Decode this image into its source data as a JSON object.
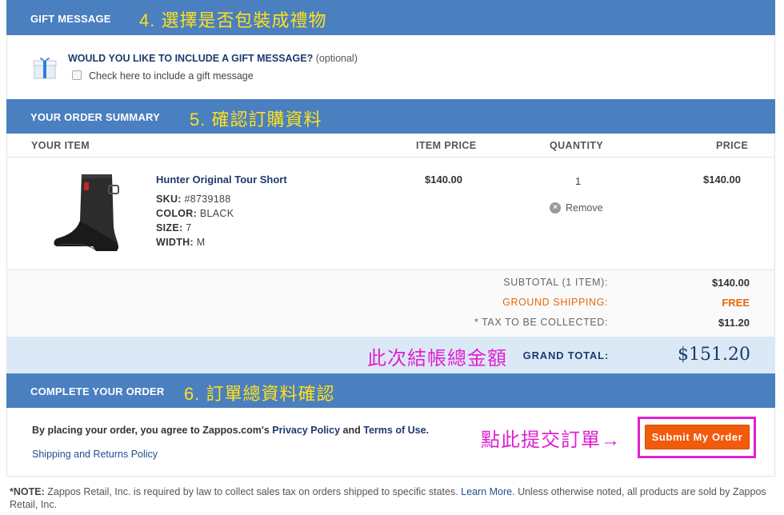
{
  "gift": {
    "bar_title": "GIFT MESSAGE",
    "annotation": "4. 選擇是否包裝成禮物",
    "question": "WOULD YOU LIKE TO INCLUDE A GIFT MESSAGE?",
    "optional": "(optional)",
    "checkbox_label": "Check here to include a gift message",
    "checked": false
  },
  "summary": {
    "bar_title": "YOUR ORDER SUMMARY",
    "annotation": "5. 確認訂購資料",
    "columns": {
      "item": "YOUR ITEM",
      "item_price": "ITEM PRICE",
      "quantity": "QUANTITY",
      "price": "PRICE"
    },
    "product": {
      "name": "Hunter Original Tour Short",
      "sku_label": "SKU:",
      "sku": "#8739188",
      "color_label": "COLOR:",
      "color": "BLACK",
      "size_label": "SIZE:",
      "size": "7",
      "width_label": "WIDTH:",
      "width": "M",
      "item_price": "$140.00",
      "quantity": "1",
      "price": "$140.00",
      "remove_label": "Remove",
      "image_icon": "rain-boot"
    },
    "totals": {
      "subtotal_label": "SUBTOTAL (1 ITEM):",
      "subtotal": "$140.00",
      "shipping_label": "GROUND SHIPPING:",
      "shipping": "FREE",
      "tax_label": "* TAX TO BE COLLECTED:",
      "tax": "$11.20",
      "grand_annotation": "此次結帳總金額",
      "grand_label": "GRAND TOTAL:",
      "grand_total": "$151.20"
    }
  },
  "complete": {
    "bar_title": "COMPLETE YOUR ORDER",
    "annotation": "6. 訂單總資料確認",
    "agree_prefix": "By placing your order, you agree to Zappos.com's",
    "privacy_link": "Privacy Policy",
    "agree_and": "and",
    "terms_link": "Terms of Use",
    "agree_suffix": ".",
    "shipping_link": "Shipping and Returns Policy",
    "submit_annotation": "點此提交訂單→",
    "submit_label": "Submit My Order"
  },
  "note": {
    "label": "*NOTE:",
    "text": "Zappos Retail, Inc. is required by law to collect sales tax on orders shipped to specific states.",
    "learn_more": "Learn More.",
    "text2": "Unless otherwise noted, all products are sold by Zappos Retail, Inc."
  },
  "colors": {
    "bar_blue": "#4a7fc0",
    "annotation_yellow": "#ffe11a",
    "annotation_magenta": "#e020d0",
    "submit_orange": "#f25a0c",
    "shipping_orange": "#e8670c",
    "grand_band": "#dbe9f6"
  }
}
